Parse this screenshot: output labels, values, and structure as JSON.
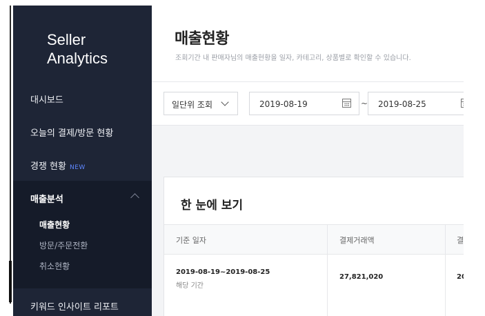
{
  "sidebar": {
    "brand": "Seller\nAnalytics",
    "items": [
      {
        "label": "대시보드"
      },
      {
        "label": "오늘의 결제/방문 현황"
      },
      {
        "label": "경쟁 현황",
        "badge": "NEW"
      }
    ],
    "section": {
      "label": "매출분석",
      "subitems": [
        {
          "label": "매출현황",
          "active": true
        },
        {
          "label": "방문/주문전환",
          "active": false
        },
        {
          "label": "취소현황",
          "active": false
        }
      ]
    },
    "next_item_partial": "키워드 인사이트 리포트"
  },
  "header": {
    "title": "매출현황",
    "description": "조회기간 내 판매자님의 매출현황을 일자, 카테고리, 상품별로 확인할 수 있습니다."
  },
  "filters": {
    "period_select": "일단위 조회",
    "start_date": "2019-08-19",
    "separator": "~",
    "end_date": "2019-08-25"
  },
  "summary": {
    "title": "한 눈에 보기",
    "columns": [
      "기준 일자",
      "결제거래액",
      "결"
    ],
    "row": {
      "date_range": "2019-08-19~2019-08-25",
      "date_sub": "해당 기간",
      "amount": "27,821,020",
      "partial": "20"
    }
  },
  "colors": {
    "sidebar_bg": "#1e2536",
    "sidebar_section_bg": "#151b29",
    "accent_badge": "#5f87ff"
  }
}
